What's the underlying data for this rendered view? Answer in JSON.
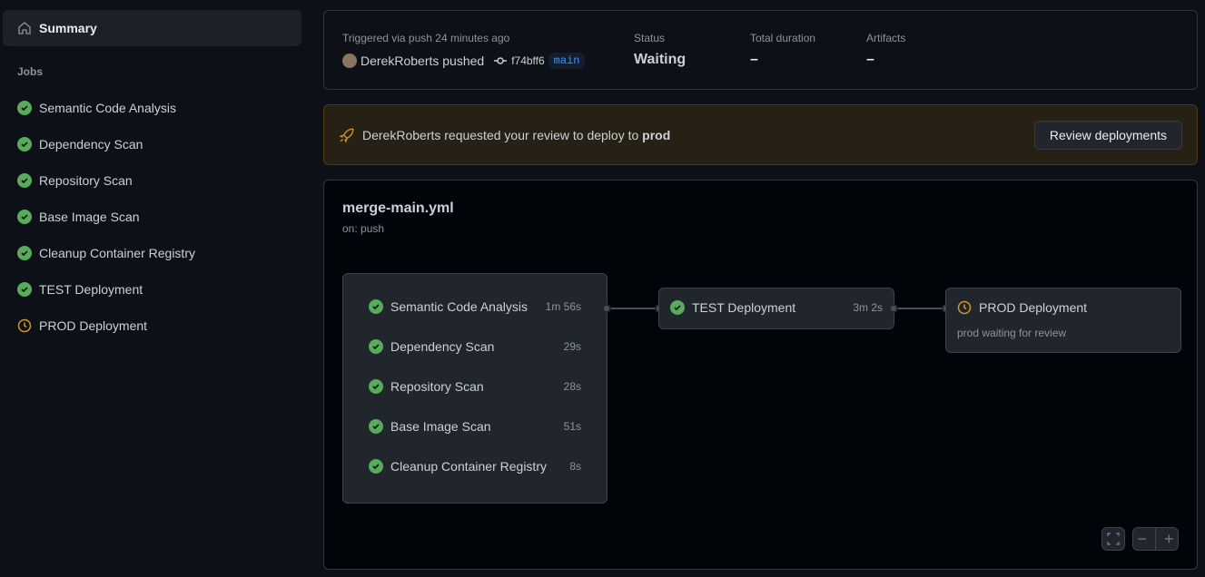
{
  "sidebar": {
    "summary": "Summary",
    "jobs_heading": "Jobs",
    "jobs": [
      {
        "label": "Semantic Code Analysis",
        "status": "success"
      },
      {
        "label": "Dependency Scan",
        "status": "success"
      },
      {
        "label": "Repository Scan",
        "status": "success"
      },
      {
        "label": "Base Image Scan",
        "status": "success"
      },
      {
        "label": "Cleanup Container Registry",
        "status": "success"
      },
      {
        "label": "TEST Deployment",
        "status": "success"
      },
      {
        "label": "PROD Deployment",
        "status": "waiting"
      }
    ]
  },
  "run": {
    "triggered": "Triggered via push 24 minutes ago",
    "actor": "DerekRoberts pushed",
    "commit": "f74bff6",
    "branch": "main",
    "status_label": "Status",
    "status": "Waiting",
    "duration_label": "Total duration",
    "duration": "–",
    "artifacts_label": "Artifacts",
    "artifacts": "–"
  },
  "banner": {
    "pre": "DerekRoberts requested your review to deploy to ",
    "env": "prod",
    "button": "Review deployments"
  },
  "workflow": {
    "name": "merge-main.yml",
    "trigger": "on: push",
    "group": [
      {
        "label": "Semantic Code Analysis",
        "time": "1m 56s"
      },
      {
        "label": "Dependency Scan",
        "time": "29s"
      },
      {
        "label": "Repository Scan",
        "time": "28s"
      },
      {
        "label": "Base Image Scan",
        "time": "51s"
      },
      {
        "label": "Cleanup Container Registry",
        "time": "8s"
      }
    ],
    "test": {
      "label": "TEST Deployment",
      "time": "3m 2s"
    },
    "prod": {
      "label": "PROD Deployment",
      "note": "prod waiting for review"
    }
  },
  "colors": {
    "success": "#57ab5a",
    "waiting": "#d29922"
  }
}
